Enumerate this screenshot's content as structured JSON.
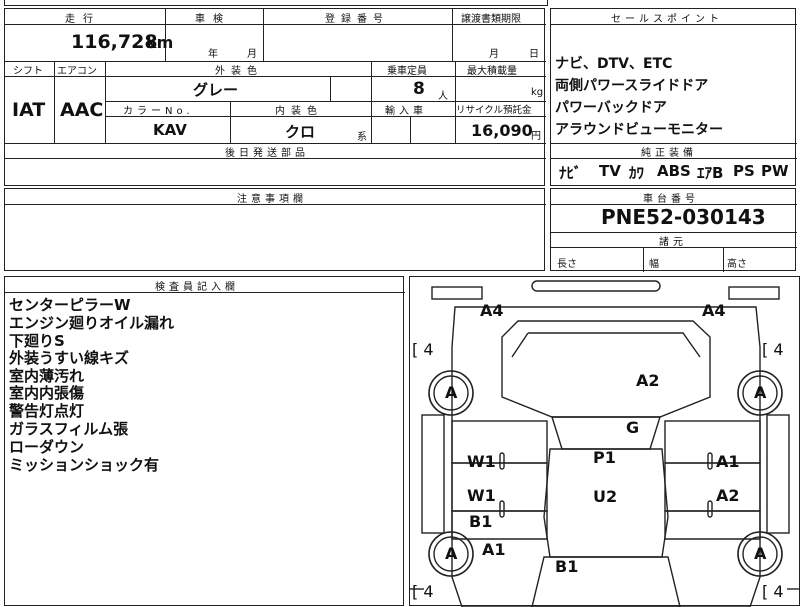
{
  "top_strip": {
    "left_fragment": "",
    "center_fragment": ""
  },
  "headers": {
    "mileage": "走行",
    "inspection": "車検",
    "registration": "登録番号",
    "transfer_deadline": "譲渡書類期限",
    "sales_point": "セールスポイント",
    "shift": "シフト",
    "aircon": "エアコン",
    "exterior_color": "外装色",
    "capacity": "乗車定員",
    "max_load": "最大積載量",
    "color_no": "カラーNo.",
    "interior_color": "内装色",
    "import": "輸入車",
    "recycle": "リサイクル預託金",
    "later_parts": "後日発送部品",
    "genuine_equipment": "純正装備",
    "cautions": "注意事項欄",
    "chassis_no": "車台番号",
    "dimensions": "諸元",
    "inspector_notes": "検査員記入欄"
  },
  "values": {
    "mileage": "116,728",
    "mileage_unit": "km",
    "year_unit": "年",
    "month_unit": "月",
    "deadline_month": "月",
    "deadline_day": "日",
    "shift": "IAT",
    "aircon": "AAC",
    "exterior_color": "グレー",
    "capacity": "8",
    "capacity_unit": "人",
    "load_unit": "kg",
    "color_no": "KAV",
    "interior_color": "クロ",
    "interior_suffix": "系",
    "recycle": "16,090",
    "recycle_unit": "円",
    "chassis_no": "PNE52-030143",
    "length_label": "長さ",
    "width_label": "幅",
    "height_label": "高さ"
  },
  "sales_points": [
    "ナビ、DTV、ETC",
    "両側パワースライドドア",
    "パワーバックドア",
    "アラウンドビューモニター"
  ],
  "genuine_equipment": [
    "ﾅﾋﾞ",
    "TV",
    "ｶﾜ",
    "ABS",
    "ｴｱB",
    "PS",
    "PW"
  ],
  "inspector_notes": [
    "センターピラーW",
    "エンジン廻りオイル漏れ",
    "下廻りS",
    "外装うすい線キズ",
    "室内薄汚れ",
    "室内内張傷",
    "警告灯点灯",
    "ガラスフィルム張",
    "ローダウン",
    "ミッションショック有"
  ],
  "diagram": {
    "tire_count_tl": "[ 4",
    "tire_count_tr": "[ 4",
    "tire_count_bl": "[ 4",
    "tire_count_br": "[ 4",
    "wheel_tl": "A",
    "wheel_tr": "A",
    "wheel_bl": "A",
    "wheel_br": "A",
    "front_left": "A4",
    "front_right": "A4",
    "hood": "A2",
    "windshield": "G",
    "roof_front": "P1",
    "roof_rear": "U2",
    "left_front_door": "W1",
    "left_rear_door": "W1",
    "left_sill": "B1",
    "left_rear_quarter": "A1",
    "right_front_door": "A1",
    "right_rear_door": "A2",
    "rear": "B1"
  }
}
